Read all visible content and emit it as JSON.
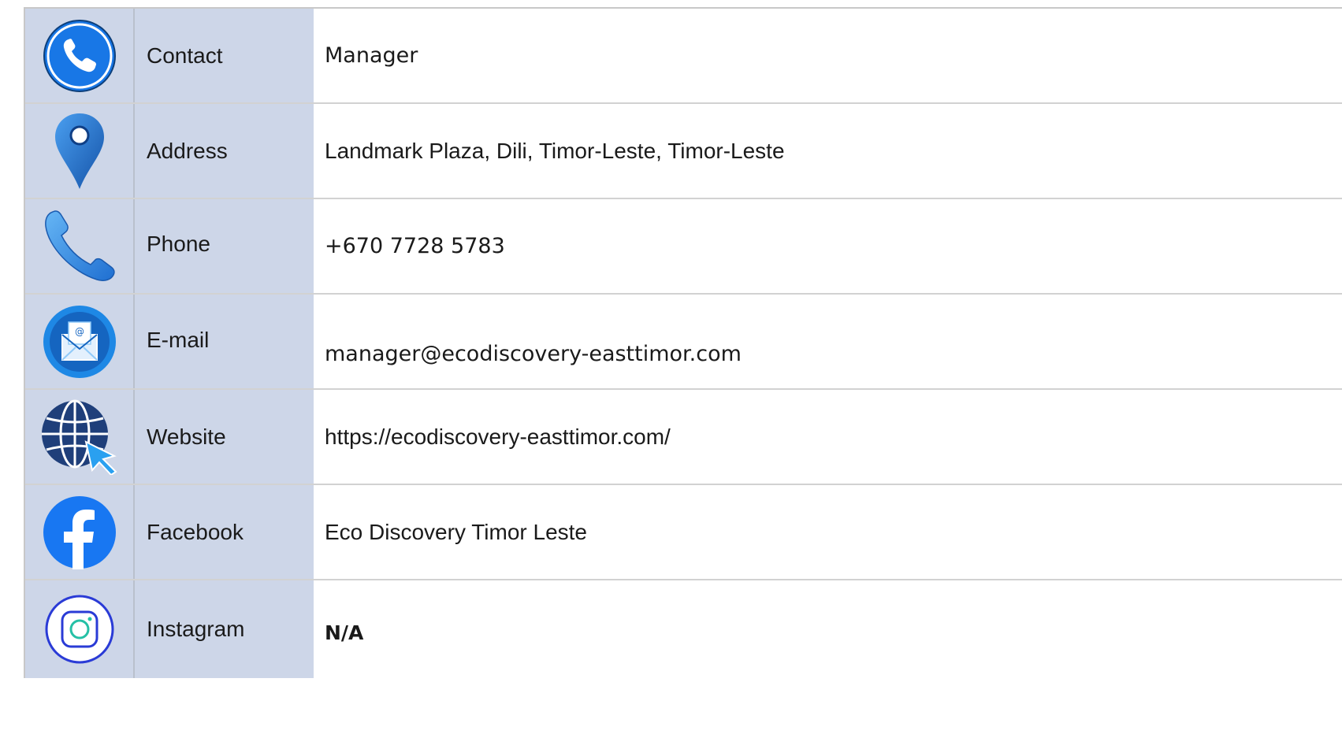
{
  "rows": [
    {
      "key": "contact",
      "label": "Contact",
      "value": "Manager",
      "icon": "phone-circle-icon"
    },
    {
      "key": "address",
      "label": "Address",
      "value": "Landmark Plaza, Dili, Timor-Leste, Timor-Leste",
      "icon": "map-pin-icon"
    },
    {
      "key": "phone",
      "label": "Phone",
      "value": "+670 7728 5783",
      "icon": "phone-handset-icon"
    },
    {
      "key": "email",
      "label": "E-mail",
      "value": "manager@ecodiscovery-easttimor.com",
      "icon": "email-icon"
    },
    {
      "key": "website",
      "label": "Website",
      "value": "https://ecodiscovery-easttimor.com/",
      "icon": "globe-cursor-icon"
    },
    {
      "key": "facebook",
      "label": "Facebook",
      "value": "Eco Discovery Timor Leste",
      "icon": "facebook-icon"
    },
    {
      "key": "instagram",
      "label": "Instagram",
      "value": "N/A",
      "icon": "instagram-icon"
    }
  ],
  "colors": {
    "label_bg": "#cdd6e8",
    "value_bg": "#ffffff",
    "icon_blue": "#1e88e5",
    "globe_navy": "#1f3f7a"
  }
}
